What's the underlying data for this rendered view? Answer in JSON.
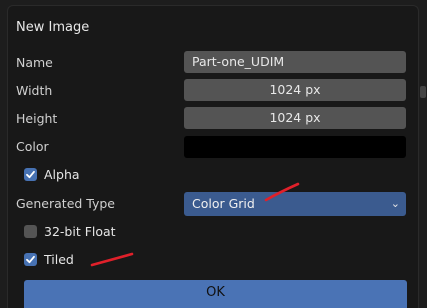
{
  "dialog": {
    "title": "New Image",
    "name_label": "Name",
    "name_value": "Part-one_UDIM",
    "width_label": "Width",
    "width_value": "1024 px",
    "height_label": "Height",
    "height_value": "1024 px",
    "color_label": "Color",
    "color_value": "#000000",
    "alpha_label": "Alpha",
    "alpha_checked": true,
    "generated_type_label": "Generated Type",
    "generated_type_value": "Color Grid",
    "float32_label": "32-bit Float",
    "float32_checked": false,
    "tiled_label": "Tiled",
    "tiled_checked": true,
    "ok_label": "OK"
  },
  "annotations": {
    "color": "#e0202a"
  },
  "icons": {
    "dropdown": "chevron-down-icon",
    "check": "checkmark-icon"
  }
}
